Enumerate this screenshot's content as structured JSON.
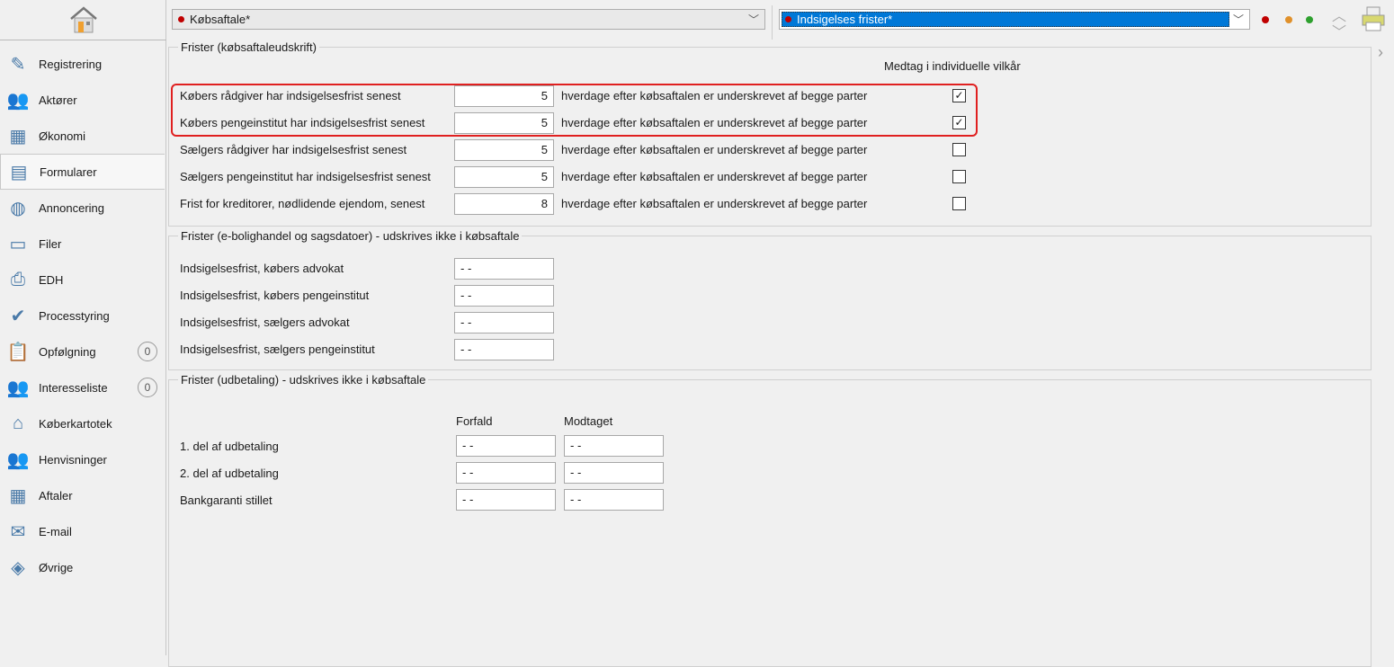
{
  "sidebar": {
    "items": [
      {
        "label": "Registrering",
        "icon": "pen-icon"
      },
      {
        "label": "Aktører",
        "icon": "people-icon"
      },
      {
        "label": "Økonomi",
        "icon": "calculator-icon"
      },
      {
        "label": "Formularer",
        "icon": "form-icon"
      },
      {
        "label": "Annoncering",
        "icon": "globe-icon"
      },
      {
        "label": "Filer",
        "icon": "folder-icon"
      },
      {
        "label": "EDH",
        "icon": "printer-icon"
      },
      {
        "label": "Processtyring",
        "icon": "check-icon"
      },
      {
        "label": "Opfølgning",
        "icon": "clipboard-icon",
        "badge": "0"
      },
      {
        "label": "Interesseliste",
        "icon": "people-icon",
        "badge": "0"
      },
      {
        "label": "Køberkartotek",
        "icon": "house-icon"
      },
      {
        "label": "Henvisninger",
        "icon": "people-icon"
      },
      {
        "label": "Aftaler",
        "icon": "calendar-icon"
      },
      {
        "label": "E-mail",
        "icon": "email-icon"
      },
      {
        "label": "Øvrige",
        "icon": "stack-icon"
      }
    ]
  },
  "toolbar": {
    "document_select": "Købsaftale*",
    "section_select": "Indsigelses frister*",
    "status_colors": [
      "#c00000",
      "#e0902a",
      "#2ea02e"
    ]
  },
  "group1": {
    "title": "Frister (købsaftaleudskrift)",
    "column_header": "Medtag i individuelle vilkår",
    "rows": [
      {
        "label": "Købers rådgiver har indsigelsesfrist senest",
        "value": "5",
        "suffix": "hverdage efter købsaftalen er underskrevet af begge parter",
        "checked": true
      },
      {
        "label": "Købers pengeinstitut har indsigelsesfrist senest",
        "value": "5",
        "suffix": "hverdage efter købsaftalen er underskrevet af begge parter",
        "checked": true
      },
      {
        "label": "Sælgers rådgiver har indsigelsesfrist senest",
        "value": "5",
        "suffix": "hverdage efter købsaftalen er underskrevet af begge parter",
        "checked": false
      },
      {
        "label": "Sælgers pengeinstitut har indsigelsesfrist senest",
        "value": "5",
        "suffix": "hverdage efter købsaftalen er underskrevet af begge parter",
        "checked": false
      },
      {
        "label": "Frist for kreditorer, nødlidende ejendom, senest",
        "value": "8",
        "suffix": "hverdage efter købsaftalen er underskrevet af begge parter",
        "checked": false
      }
    ]
  },
  "group2": {
    "title": "Frister (e-bolighandel og sagsdatoer) - udskrives ikke i købsaftale",
    "rows": [
      {
        "label": "Indsigelsesfrist, købers advokat",
        "value": "- -"
      },
      {
        "label": "Indsigelsesfrist, købers pengeinstitut",
        "value": "- -"
      },
      {
        "label": "Indsigelsesfrist, sælgers advokat",
        "value": "- -"
      },
      {
        "label": "Indsigelsesfrist, sælgers pengeinstitut",
        "value": "- -"
      }
    ]
  },
  "group3": {
    "title": "Frister (udbetaling) - udskrives ikke i købsaftale",
    "col1": "Forfald",
    "col2": "Modtaget",
    "rows": [
      {
        "label": "1. del af udbetaling",
        "forfald": "- -",
        "modtaget": "- -"
      },
      {
        "label": "2. del af udbetaling",
        "forfald": "- -",
        "modtaget": "- -"
      },
      {
        "label": "Bankgaranti stillet",
        "forfald": "- -",
        "modtaget": "- -"
      }
    ]
  }
}
